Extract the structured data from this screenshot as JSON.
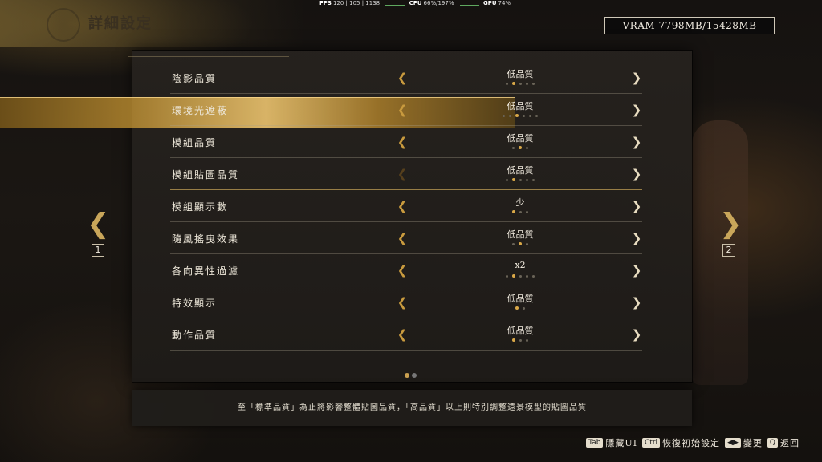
{
  "header": {
    "title": "詳細設定"
  },
  "perf": {
    "fps_label": "FPS",
    "fps_value": "120 | 105 | 1138",
    "cpu_label": "CPU",
    "cpu_value": "66%/197%",
    "gpu_label": "GPU",
    "gpu_value": "74%"
  },
  "vram": {
    "text": "VRAM 7798MB/15428MB"
  },
  "settings": [
    {
      "label": "陰影品質",
      "value": "低品質",
      "level_count": 5,
      "level_selected": 2,
      "dots": [
        false,
        true,
        false,
        false,
        false
      ]
    },
    {
      "label": "環境光遮蔽",
      "value": "低品質",
      "level_count": 6,
      "level_selected": 3,
      "dots": [
        false,
        false,
        true,
        false,
        false,
        false
      ]
    },
    {
      "label": "模組品質",
      "value": "低品質",
      "level_count": 3,
      "level_selected": 2,
      "dots": [
        false,
        true,
        false
      ]
    },
    {
      "label": "模組貼圖品質",
      "value": "低品質",
      "level_count": 5,
      "level_selected": 2,
      "dots": [
        false,
        true,
        false,
        false,
        false
      ]
    },
    {
      "label": "模組顯示數",
      "value": "少",
      "level_count": 3,
      "level_selected": 1,
      "dots": [
        true,
        false,
        false
      ]
    },
    {
      "label": "隨風搖曳效果",
      "value": "低品質",
      "level_count": 3,
      "level_selected": 2,
      "dots": [
        false,
        true,
        false
      ]
    },
    {
      "label": "各向異性過濾",
      "value": "x2",
      "level_count": 5,
      "level_selected": 2,
      "dots": [
        false,
        true,
        false,
        false,
        false
      ]
    },
    {
      "label": "特效顯示",
      "value": "低品質",
      "level_count": 2,
      "level_selected": 1,
      "dots": [
        true,
        false
      ]
    },
    {
      "label": "動作品質",
      "value": "低品質",
      "level_count": 3,
      "level_selected": 1,
      "dots": [
        true,
        false,
        false
      ]
    }
  ],
  "selected_index": 3,
  "pagination": {
    "pages": 2,
    "current": 1
  },
  "side_nav": {
    "prev_key": "1",
    "next_key": "2"
  },
  "description": "至「標準品質」為止將影響整體貼圖品質，「高品質」以上則特別調整遠景模型的貼圖品質",
  "hints": [
    {
      "key": "Tab",
      "label": "隱藏UI"
    },
    {
      "key": "Ctrl",
      "label": "恢復初始設定"
    },
    {
      "key": "◀▶",
      "label": "變更"
    },
    {
      "key": "Q",
      "label": "返回"
    }
  ],
  "colors": {
    "accent_gold": "#d9a848",
    "selected_row": "#c9963a"
  }
}
